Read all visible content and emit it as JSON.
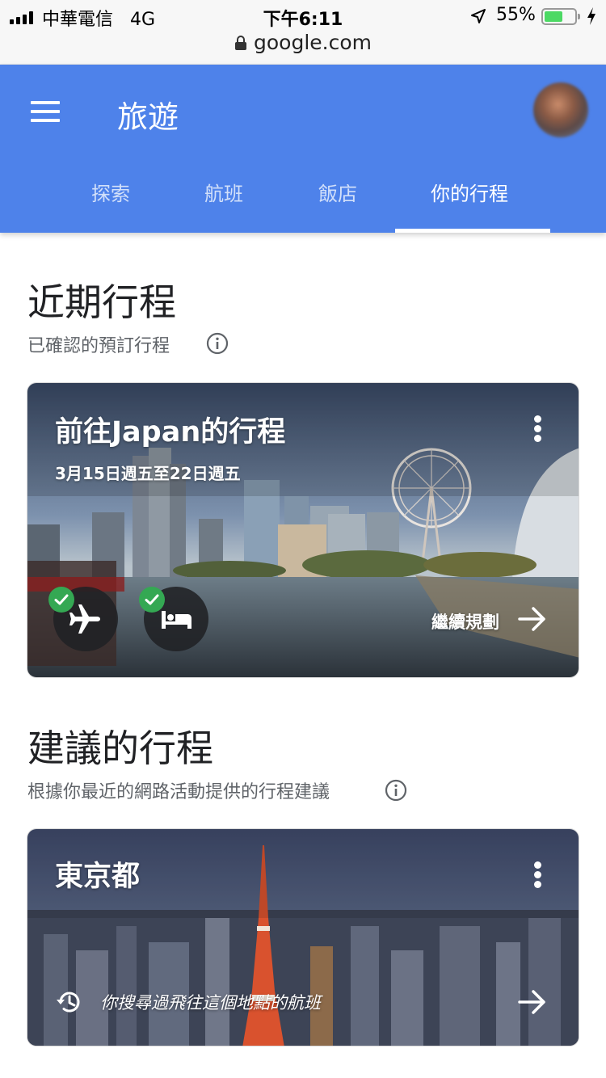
{
  "status_bar": {
    "carrier": "中華電信",
    "network": "4G",
    "time": "下午6:11",
    "battery": "55%",
    "url": "google.com"
  },
  "app_bar": {
    "title": "旅遊",
    "tabs": [
      {
        "label": "探索"
      },
      {
        "label": "航班"
      },
      {
        "label": "飯店"
      },
      {
        "label": "你的行程"
      }
    ],
    "active_tab": "你的行程"
  },
  "upcoming": {
    "title": "近期行程",
    "subtitle": "已確認的預訂行程",
    "trip": {
      "title": "前往Japan的行程",
      "dates": "3月15日週五至22日週五",
      "flight_icon": "airplane-icon",
      "hotel_icon": "bed-icon",
      "continue_label": "繼續規劃"
    }
  },
  "suggested": {
    "title": "建議的行程",
    "subtitle": "根據你最近的網路活動提供的行程建議",
    "trip": {
      "title": "東京都",
      "reason": "你搜尋過飛往這個地點的航班"
    }
  },
  "colors": {
    "app_bar": "#4e82ea",
    "check": "#34a853",
    "battery": "#4cd964"
  }
}
